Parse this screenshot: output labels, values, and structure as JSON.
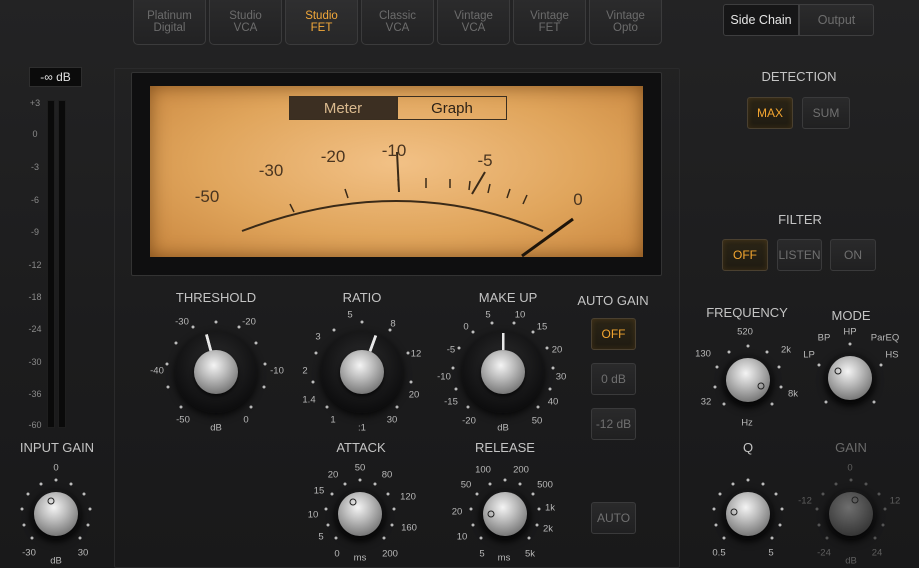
{
  "models": [
    {
      "label": "Platinum\nDigital",
      "active": false
    },
    {
      "label": "Studio\nVCA",
      "active": false
    },
    {
      "label": "Studio\nFET",
      "active": true
    },
    {
      "label": "Classic\nVCA",
      "active": false
    },
    {
      "label": "Vintage\nVCA",
      "active": false
    },
    {
      "label": "Vintage\nFET",
      "active": false
    },
    {
      "label": "Vintage\nOpto",
      "active": false
    }
  ],
  "side_chain": {
    "side_chain_label": "Side Chain",
    "output_label": "Output"
  },
  "input": {
    "level_readout": "-∞ dB",
    "scale": [
      "+3",
      "0",
      "-3",
      "-6",
      "-9",
      "-12",
      "-18",
      "-24",
      "-30",
      "-36",
      "-60"
    ],
    "gain_label": "INPUT GAIN",
    "gain_top": "0",
    "gain_min": "-30",
    "gain_max": "30",
    "gain_unit": "dB"
  },
  "meter": {
    "tab_meter": "Meter",
    "tab_graph": "Graph",
    "scale": [
      "-50",
      "-30",
      "-20",
      "-10",
      "-5",
      "0"
    ]
  },
  "threshold": {
    "label": "THRESHOLD",
    "scale": [
      "-30",
      "-20",
      "-40",
      "-10",
      "-50",
      "0"
    ],
    "unit": "dB"
  },
  "ratio": {
    "label": "RATIO",
    "scale": [
      "5",
      "3",
      "8",
      "2",
      "12",
      "1.4",
      "20",
      "1",
      "30"
    ],
    "unit": ":1"
  },
  "makeup": {
    "label": "MAKE UP",
    "scale": [
      "5",
      "10",
      "0",
      "15",
      "-5",
      "20",
      "-10",
      "30",
      "-15",
      "40",
      "-20",
      "50"
    ],
    "unit": "dB"
  },
  "auto_gain": {
    "label": "AUTO GAIN",
    "off": "OFF",
    "zero": "0 dB",
    "minus12": "-12 dB",
    "auto": "AUTO"
  },
  "attack": {
    "label": "ATTACK",
    "scale": [
      "50",
      "20",
      "80",
      "15",
      "120",
      "10",
      "160",
      "5",
      "0",
      "200"
    ],
    "unit": "ms"
  },
  "release": {
    "label": "RELEASE",
    "scale": [
      "100",
      "200",
      "50",
      "500",
      "20",
      "1k",
      "10",
      "2k",
      "5",
      "5k"
    ],
    "unit": "ms"
  },
  "detection": {
    "label": "DETECTION",
    "max": "MAX",
    "sum": "SUM"
  },
  "filter": {
    "label": "FILTER",
    "off": "OFF",
    "listen": "LISTEN",
    "on": "ON"
  },
  "frequency": {
    "label": "FREQUENCY",
    "scale": [
      "520",
      "130",
      "2k",
      "32",
      "8k"
    ],
    "unit": "Hz"
  },
  "mode": {
    "label": "MODE",
    "scale": [
      "HP",
      "BP",
      "ParEQ",
      "LP",
      "HS"
    ]
  },
  "q": {
    "label": "Q",
    "min": "0.5",
    "max": "5"
  },
  "gain": {
    "label": "GAIN",
    "top": "0",
    "min": "-12",
    "max": "12",
    "bmin": "-24",
    "bmax": "24",
    "unit": "dB"
  },
  "colors": {
    "accent": "#f4a630",
    "meter_face": "#e4a95e"
  }
}
